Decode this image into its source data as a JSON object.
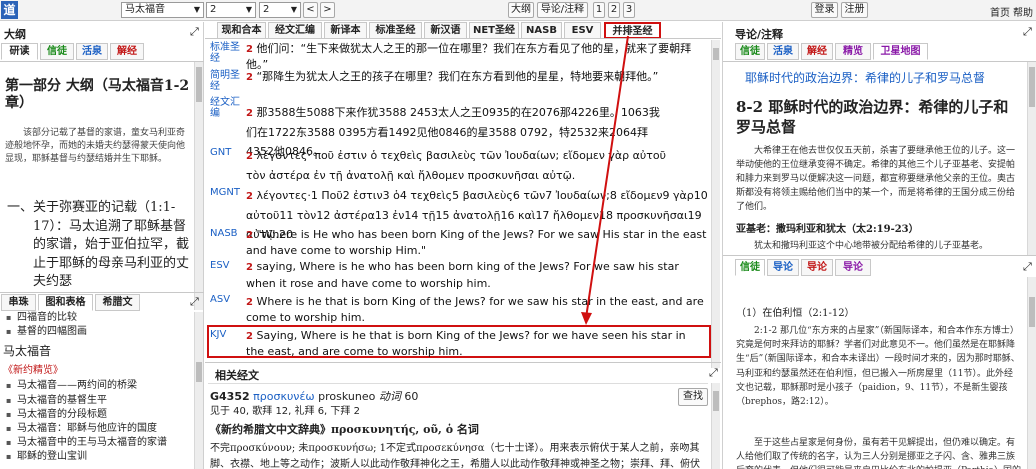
{
  "app": {
    "logo": "道"
  },
  "toolbar": {
    "book": "马太福音",
    "chapter": "2",
    "verse": "2",
    "prev": "<",
    "next": ">",
    "outline_btn": "大纲",
    "guide_btn": "导论/注释",
    "col1": "1",
    "col2": "2",
    "col3": "3",
    "login": "登录",
    "register": "注册",
    "home": "首页",
    "help": "帮助"
  },
  "left": {
    "title": "大纲",
    "tabs": [
      "研读",
      "信徒",
      "活泉",
      "解经"
    ],
    "heading": "第一部分 大纲（马太福音1-2章）",
    "intro": "该部分记载了基督的家谱，童女马利亚奇迹般地怀孕，而她的未婚夫约瑟得蒙天使向他显现，耶稣基督与约瑟结婚并生下耶稣。",
    "big": "一、关于弥赛亚的记载（1:1-17）：马太追溯了耶稣基督的家谱，始于亚伯拉罕，截止于耶稣的母亲马利亚的丈夫约瑟",
    "tabs2": [
      "串珠",
      "图和表格",
      "希腊文"
    ],
    "list_pre": [
      "四福音的比较",
      "基督的四幅图画"
    ],
    "book_title": "马太福音",
    "section": "《新约精览》",
    "list": [
      "马太福音——两约间的桥梁",
      "马太福音的基督生平",
      "马太福音的分段标题",
      "马太福音：耶稣与他应许的国度",
      "马太福音中的王与马太福音的家谱",
      "耶稣的登山宝训"
    ]
  },
  "center": {
    "tabs": [
      "现和合本",
      "经文汇编",
      "新译本",
      "标准圣经",
      "新汉语",
      "NET圣经",
      "NASB",
      "ESV",
      "并排圣经"
    ],
    "verses": [
      {
        "label": "标准圣经",
        "num": "2",
        "text": "他们问：“生下来做犹太人之王的那一位在哪里？我们在东方看见了他的星，就来了要朝拜他。”"
      },
      {
        "label": "简明圣经",
        "num": "2",
        "text": "“那降生为犹太人之王的孩子在哪里？我们在东方看到他的星星，特地要来朝拜他。”"
      },
      {
        "label": "经文汇编",
        "num": "2",
        "text": "那3588生5088下来作犹3588 2453太人之王0935的在2076那4226里。1063我们在1722东3588 0395方看1492见他0846的星3588 0792，特2532来2064拜4352他0846。"
      },
      {
        "label": "GNT",
        "num": "2",
        "text": "λέγοντες· ποῦ ἐστιν ὁ τεχθεὶς βασιλεὺς τῶν Ἰουδαίων; εἴδομεν γὰρ αὐτοῦ τὸν ἀστέρα ἐν τῇ ἀνατολῇ καὶ ἤλθομεν προσκυνῆσαι αὐτῷ."
      },
      {
        "label": "MGNT",
        "num": "2",
        "text": "λέγοντες·1 Ποῦ2 ἐστιν3 ὁ4 τεχθεὶς5 βασιλεὺς6 τῶν7 Ἰουδαίων;8 εἴδομεν9 γὰρ10 αὐτοῦ11 τὸν12 ἀστέρα13 ἐν14 τῇ15 ἀνατολῇ16 καὶ17 ἤλθομεν18 προσκυνῆσαι19 αὐτῷ.20"
      },
      {
        "label": "NASB",
        "num": "2",
        "text": "\"Where is He who has been born King of the Jews? For we saw His star in the east and have come to worship Him.\""
      },
      {
        "label": "ESV",
        "num": "2",
        "text": "saying, Where is he who has been born king of the Jews? For we saw his star when it rose and have come to worship him."
      },
      {
        "label": "ASV",
        "num": "2",
        "text": "Where is he that is born King of the Jews? for we saw his star in the east, and are come to worship him."
      },
      {
        "label": "KJV",
        "num": "2",
        "text": "Saying, Where is he that is born King of the Jews? for we have seen his star in the east, and are come to worship him."
      }
    ],
    "related": {
      "title": "相关经文",
      "word": "G4352",
      "greek": "προσκυνέω",
      "translit": "proskuneo",
      "pos": "动词",
      "count": "60",
      "stats": "见于 40, 歌拜 12, 礼拜 6, 下拜 2",
      "search_btn": "查找",
      "dict": "《新约希腊文中文辞典》προσκυνητής, οῦ, ὁ 名词",
      "line": "不完προσκύνουν; 未προσκυνήσω; 1不定式προσεκύνησα（七十士译）。用来表示俯伏于某人之前，亲吻其脚、衣襟、地上等之动作；波斯人以此动作敬拜神化之王，希腊人以此动作敬拜神或神圣之物；崇拜、拜、俯伏下、敬、崇拜、礼"
    }
  },
  "right": {
    "title": "导论/注释",
    "tabs": [
      "信徒",
      "活泉",
      "解经",
      "精览",
      "卫星地图"
    ],
    "banner": "耶稣时代的政治边界：希律的儿子和罗马总督",
    "heading": "8-2 耶稣时代的政治边界：希律的儿子和罗马总督",
    "para": "大希律王在他去世仅仅五天前，杀害了要继承他王位的儿子。这一举动使他的王位继承变得不确定。希律的其他三个儿子亚基老、安提帕和腓力来到罗马以便解决这一问题，都宣称要继承他父亲的王位。奥古斯都没有将领主赐给他们当中的某一个，而是将希律的王国分成三份给了他们。",
    "sub": "亚基老：撒玛利亚和犹太（太2:19-23）",
    "sub_para": "犹太和撒玛利亚这个中心地带被分配给希律的儿子亚基老。",
    "tabs2": [
      "信徒",
      "导论",
      "导论",
      "导论"
    ],
    "c_heading": "（1）在伯利恒（2:1-12）",
    "c_para1": "2:1-2 那几位“东方来的占星家”（新国际译本，和合本作东方博士）究竟是何时来拜访的耶稣？学者们对此意见不一。他们虽然是在耶稣降生“后”（新国际译本，和合本未译出）一段时间才来的，因为那时耶稣、马利亚和约瑟虽然还在伯利恒，但已搬入一所房屋里（11节）。此外经文也记载，耶稣那时是小孩子（paidion，9、11节），不是新生婴孩（brephos，路2:12）。",
    "c_para2": "至于这些占星家是何身份，虽有若干见解提出，但仍难以确定。有人给他们取了传统的名字，认为三人分别是挪亚之子闪、含、雅弗三族后裔的代表。但他们很可能是来自巴比伦东北的帕提亚（Parthia）国的外邦贵胄，掌神特别启示，知道犹太人之王已"
  }
}
